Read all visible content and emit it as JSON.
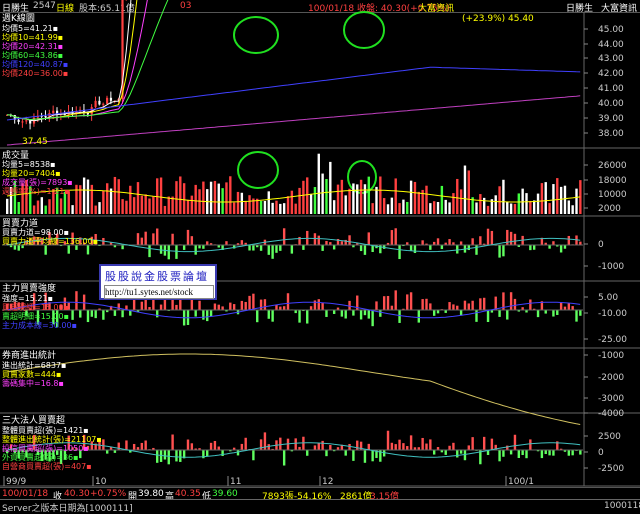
{
  "header": {
    "period": "日線",
    "stock_name": "日勝生",
    "code": "2547",
    "capital": "股本:65.11億",
    "name_right": "日勝生",
    "date_price": "100/01/18 收盤: 40.30(+0.75%)",
    "source": "大富資訊",
    "source_right": "大富資訊",
    "count": "03"
  },
  "panels": {
    "price": {
      "title": "週K線圖",
      "ma": [
        {
          "label": "均價5",
          "value": "41.21",
          "color": "#ffffff"
        },
        {
          "label": "均價10",
          "value": "41.99",
          "color": "#ffff00"
        },
        {
          "label": "均價20",
          "value": "42.31",
          "color": "#ff40ff"
        },
        {
          "label": "均價60",
          "value": "43.86",
          "color": "#40ff40"
        },
        {
          "label": "均價120",
          "value": "40.87",
          "color": "#4040ff"
        },
        {
          "label": "均價240",
          "value": "36.00",
          "color": "#ff4040"
        }
      ],
      "high_label": "(+23.9%) 45.40",
      "low_label": "37.45",
      "ticks": [
        "45.00",
        "44.00",
        "43.00",
        "42.00",
        "41.00",
        "40.00",
        "39.00",
        "38.00"
      ]
    },
    "volume": {
      "title": "成交量",
      "items": [
        {
          "label": "均量5",
          "value": "8538",
          "color": "#ffffff"
        },
        {
          "label": "均量20",
          "value": "7404",
          "color": "#ffff00"
        },
        {
          "label": "成交量(張)",
          "value": "7893",
          "color": "#ff40ff"
        },
        {
          "label": "週轉率(%)",
          "value": "1.21",
          "color": "#ff4040"
        }
      ],
      "ticks": [
        "26000",
        "18000",
        "10000",
        "2000"
      ]
    },
    "force": {
      "title": "買賣力道",
      "items": [
        {
          "label": "買賣力道",
          "value": "98.00",
          "color": "#ffffff"
        },
        {
          "label": "買賣力道平均線",
          "value": "136.00",
          "color": "#ffff00"
        }
      ],
      "ticks": [
        "0",
        "-1000"
      ]
    },
    "main": {
      "title": "主力買賣強度",
      "items": [
        {
          "label": "強度",
          "value": "15.21",
          "color": "#ffffff"
        },
        {
          "label": "買超明細",
          "value": "15.00",
          "color": "#ff4040"
        },
        {
          "label": "賣超明細",
          "value": "15.00",
          "color": "#40ff40"
        },
        {
          "label": "主力成本線",
          "value": "30.00",
          "color": "#4040ff"
        }
      ],
      "ticks": [
        "5.00",
        "-10.00",
        "-25.00"
      ]
    },
    "broker": {
      "title": "券商進出統計",
      "items": [
        {
          "label": "進出統計",
          "value": "6837",
          "color": "#ffffff"
        },
        {
          "label": "買賣家數",
          "value": "444",
          "color": "#ffff00"
        },
        {
          "label": "籌碼集中",
          "value": "16.8",
          "color": "#ff40ff"
        }
      ],
      "ticks": [
        "-1000",
        "-2000",
        "-3000",
        "-4000"
      ]
    },
    "inst": {
      "title": "三大法人買賣超",
      "items": [
        {
          "label": "整體買賣超(張)",
          "value": "1421",
          "color": "#ffffff"
        },
        {
          "label": "整體進出統計(張)",
          "value": "21107",
          "color": "#ffff00"
        },
        {
          "label": "投信買賣超(張)",
          "value": "1050",
          "color": "#ff40ff"
        },
        {
          "label": "外資買賣超(張)",
          "value": "36",
          "color": "#40ff40"
        },
        {
          "label": "自營商買賣超(張)",
          "value": "407",
          "color": "#ff4040"
        }
      ],
      "ticks": [
        "2500",
        "0",
        "-2500"
      ]
    }
  },
  "xaxis": {
    "labels": [
      "99/9",
      "10",
      "11",
      "12",
      "100/1"
    ]
  },
  "bottom": {
    "date": "100/01/18",
    "close_label": "收",
    "close": "40.30",
    "change": "+0.75%",
    "open_label": "開",
    "open": "39.80",
    "high_label": "高",
    "high": "40.35",
    "low_label": "低",
    "low": "39.60",
    "volume": "7893張-54.16%",
    "value": "2861億",
    "turn": "3.15億"
  },
  "status": {
    "text": "Server之版本日期為[1000111]",
    "right": "1000118"
  },
  "watermark": {
    "title": "股股說金股票論壇",
    "url": "http://tu1.sytes.net/stock"
  },
  "chart_data": {
    "type": "candlestick",
    "x": [
      "99/9",
      "10",
      "11",
      "12",
      "100/1"
    ],
    "series": [
      {
        "name": "週K線圖",
        "values": [
          39.5,
          41.5,
          44.2,
          45.4,
          40.3
        ]
      },
      {
        "name": "成交量",
        "values": [
          6000,
          9000,
          24000,
          20000,
          7893
        ]
      }
    ]
  }
}
